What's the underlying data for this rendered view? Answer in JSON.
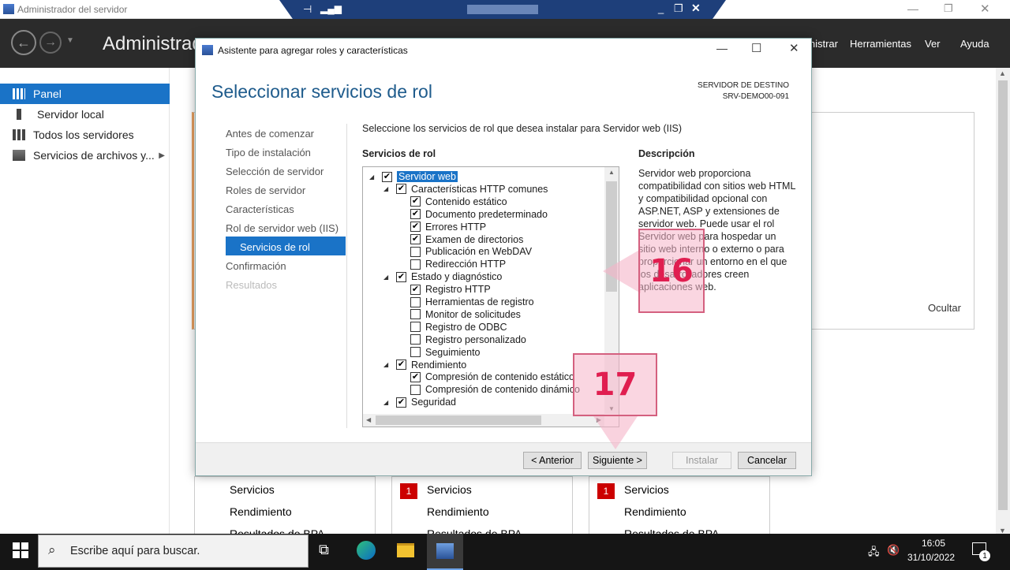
{
  "outer_window": {
    "title": "Administrador del servidor"
  },
  "server_manager": {
    "title": "Administrador del servidor · Panel",
    "menu": [
      "Administrar",
      "Herramientas",
      "Ver",
      "Ayuda"
    ]
  },
  "sidebar": {
    "items": [
      {
        "label": "Panel"
      },
      {
        "label": "Servidor local"
      },
      {
        "label": "Todos los servidores"
      },
      {
        "label": "Servicios de archivos y..."
      }
    ]
  },
  "background_panels": {
    "hide_label": "Ocultar",
    "tiles": [
      {
        "lines": [
          "Servicios",
          "Rendimiento",
          "Resultados de BPA"
        ],
        "badge": ""
      },
      {
        "lines": [
          "Servicios",
          "Rendimiento",
          "Resultados de BPA"
        ],
        "badge": "1"
      },
      {
        "lines": [
          "Servicios",
          "Rendimiento",
          "Resultados de BPA"
        ],
        "badge": "1"
      }
    ]
  },
  "dialog": {
    "title": "Asistente para agregar roles y características",
    "heading": "Seleccionar servicios de rol",
    "dest_label": "SERVIDOR DE DESTINO",
    "dest_name": "SRV-DEMO00-091",
    "nav": [
      {
        "label": "Antes de comenzar"
      },
      {
        "label": "Tipo de instalación"
      },
      {
        "label": "Selección de servidor"
      },
      {
        "label": "Roles de servidor"
      },
      {
        "label": "Características"
      },
      {
        "label": "Rol de servidor web (IIS)"
      },
      {
        "label": "Servicios de rol"
      },
      {
        "label": "Confirmación"
      },
      {
        "label": "Resultados"
      }
    ],
    "instruction": "Seleccione los servicios de rol que desea instalar para Servidor web (IIS)",
    "list_header": "Servicios de rol",
    "desc_header": "Descripción",
    "description": "Servidor web proporciona compatibilidad con sitios web HTML y compatibilidad opcional con ASP.NET, ASP y extensiones de servidor web. Puede usar el rol Servidor web para hospedar un sitio web interno o externo o para proporcionar un entorno en el que los desarrolladores creen aplicaciones web.",
    "tree": [
      {
        "label": "Servidor web",
        "checked": true,
        "level": 0,
        "expander": true,
        "selected": true
      },
      {
        "label": "Características HTTP comunes",
        "checked": true,
        "level": 1,
        "expander": true
      },
      {
        "label": "Contenido estático",
        "checked": true,
        "level": 2
      },
      {
        "label": "Documento predeterminado",
        "checked": true,
        "level": 2
      },
      {
        "label": "Errores HTTP",
        "checked": true,
        "level": 2
      },
      {
        "label": "Examen de directorios",
        "checked": true,
        "level": 2
      },
      {
        "label": "Publicación en WebDAV",
        "checked": false,
        "level": 2
      },
      {
        "label": "Redirección HTTP",
        "checked": false,
        "level": 2
      },
      {
        "label": "Estado y diagnóstico",
        "checked": true,
        "level": 1,
        "expander": true
      },
      {
        "label": "Registro HTTP",
        "checked": true,
        "level": 2
      },
      {
        "label": "Herramientas de registro",
        "checked": false,
        "level": 2
      },
      {
        "label": "Monitor de solicitudes",
        "checked": false,
        "level": 2
      },
      {
        "label": "Registro de ODBC",
        "checked": false,
        "level": 2
      },
      {
        "label": "Registro personalizado",
        "checked": false,
        "level": 2
      },
      {
        "label": "Seguimiento",
        "checked": false,
        "level": 2
      },
      {
        "label": "Rendimiento",
        "checked": true,
        "level": 1,
        "expander": true
      },
      {
        "label": "Compresión de contenido estático",
        "checked": true,
        "level": 2
      },
      {
        "label": "Compresión de contenido dinámico",
        "checked": false,
        "level": 2
      },
      {
        "label": "Seguridad",
        "checked": true,
        "level": 1,
        "expander": true
      }
    ],
    "buttons": {
      "back": "< Anterior",
      "next": "Siguiente >",
      "install": "Instalar",
      "cancel": "Cancelar"
    }
  },
  "callouts": {
    "step16": "16",
    "step17": "17"
  },
  "taskbar": {
    "search_placeholder": "Escribe aquí para buscar.",
    "time": "16:05",
    "date": "31/10/2022",
    "notifications": "1"
  }
}
